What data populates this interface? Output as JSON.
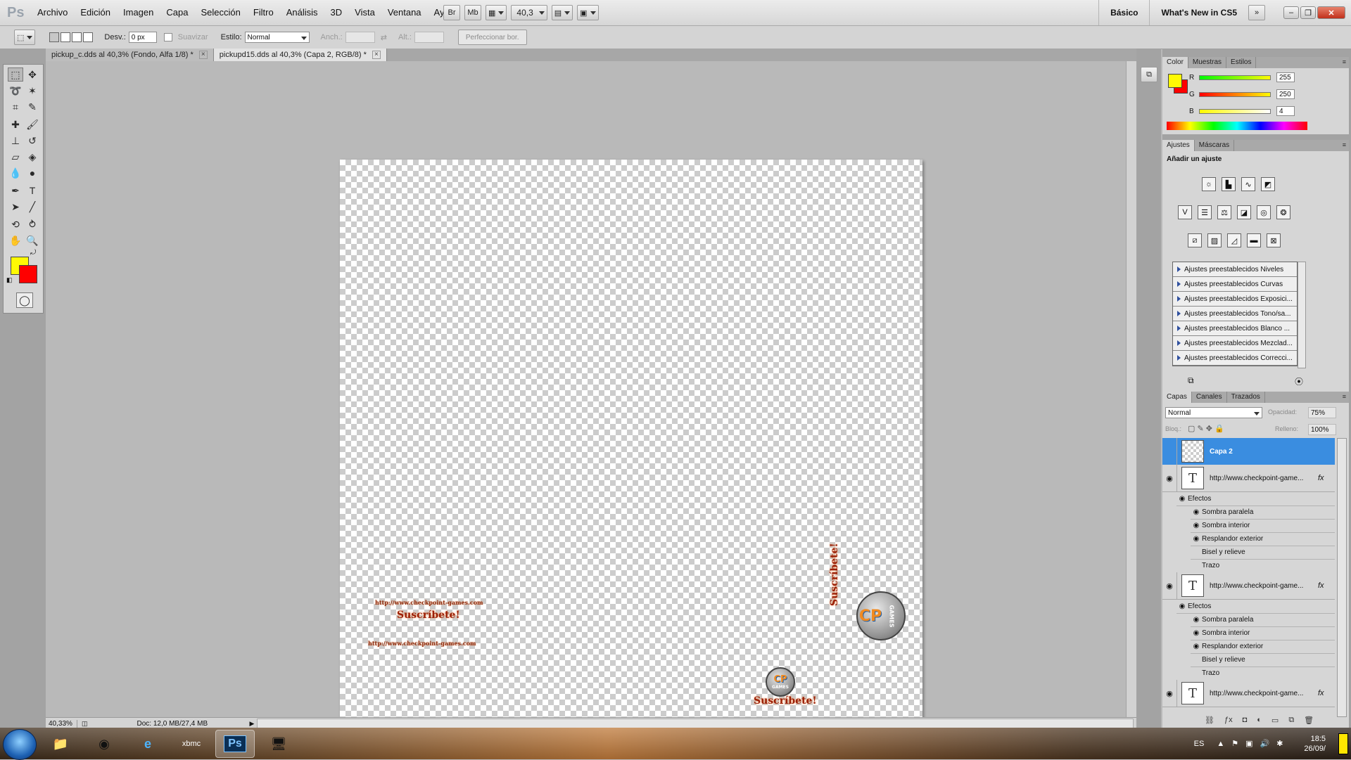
{
  "app": {
    "logo": "Ps"
  },
  "menu": [
    "Archivo",
    "Edición",
    "Imagen",
    "Capa",
    "Selección",
    "Filtro",
    "Análisis",
    "3D",
    "Vista",
    "Ventana",
    "Ayuda"
  ],
  "appbar": {
    "br": "Br",
    "mb": "Mb",
    "zoom": "40,3"
  },
  "workspace": {
    "basic": "Básico",
    "whats_new": "What's New in CS5"
  },
  "options": {
    "feather_label": "Desv.:",
    "feather_value": "0 px",
    "antialias_label": "Suavizar",
    "style_label": "Estilo:",
    "style_value": "Normal",
    "width_label": "Anch.:",
    "height_label": "Alt.:",
    "refine_button": "Perfeccionar bor."
  },
  "tabs": [
    {
      "label": "pickup_c.dds al 40,3% (Fondo, Alfa 1/8) *",
      "active": false
    },
    {
      "label": "pickupd15.dds al 40,3% (Capa 2, RGB/8) *",
      "active": true
    }
  ],
  "colors": {
    "foreground": "#fffa04",
    "background": "#ff0000",
    "accent": "#3a8de0"
  },
  "canvas": {
    "url_text": "http://www.checkpoint-games.com",
    "subscribe": "Suscríbete!",
    "logo_text_cp": "CP",
    "logo_text_games": "GAMES"
  },
  "status": {
    "zoom": "40,33%",
    "doc": "Doc: 12,0 MB/27,4 MB"
  },
  "color_panel": {
    "tabs": [
      "Color",
      "Muestras",
      "Estilos"
    ],
    "r_label": "R",
    "r": "255",
    "g_label": "G",
    "g": "250",
    "b_label": "B",
    "b": "4"
  },
  "adjust_panel": {
    "tabs": [
      "Ajustes",
      "Máscaras"
    ],
    "title": "Añadir un ajuste",
    "presets": [
      "Ajustes preestablecidos Niveles",
      "Ajustes preestablecidos Curvas",
      "Ajustes preestablecidos Exposici...",
      "Ajustes preestablecidos Tono/sa...",
      "Ajustes preestablecidos Blanco ...",
      "Ajustes preestablecidos Mezclad...",
      "Ajustes preestablecidos Correcci..."
    ]
  },
  "layers_panel": {
    "tabs": [
      "Capas",
      "Canales",
      "Trazados"
    ],
    "blend_mode": "Normal",
    "opacity_label": "Opacidad:",
    "opacity": "75%",
    "lock_label": "Bloq.:",
    "fill_label": "Relleno:",
    "fill": "100%",
    "layers": [
      {
        "name": "Capa 2"
      },
      {
        "name": "http://www.checkpoint-game..."
      },
      {
        "name": "http://www.checkpoint-game..."
      },
      {
        "name": "http://www.checkpoint-game..."
      }
    ],
    "effects_label": "Efectos",
    "effects": [
      "Sombra paralela",
      "Sombra interior",
      "Resplandor exterior",
      "Bisel y relieve",
      "Trazo"
    ],
    "fx": "fx"
  },
  "taskbar": {
    "lang": "ES",
    "time": "18:5",
    "date": "26/09/"
  }
}
